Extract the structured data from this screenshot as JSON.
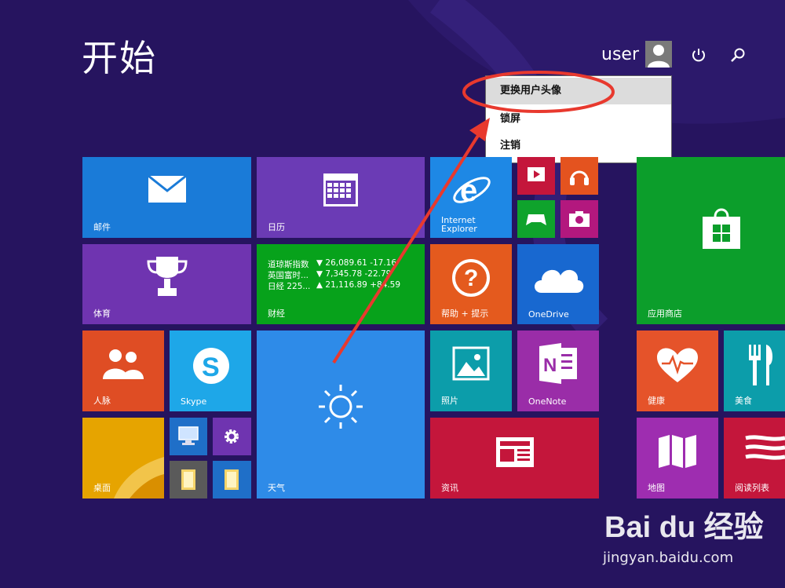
{
  "header": {
    "title": "开始",
    "user_name": "user",
    "icons": [
      "user-avatar-icon",
      "power-icon",
      "search-icon"
    ]
  },
  "user_menu": {
    "items": [
      {
        "label": "更换用户头像",
        "highlighted": true
      },
      {
        "label": "锁屏",
        "highlighted": false
      },
      {
        "label": "注销",
        "highlighted": false
      }
    ]
  },
  "tiles": {
    "mail": "邮件",
    "calendar": "日历",
    "ie": "Internet\nExplorer",
    "sports": "体育",
    "finance": "财经",
    "help": "帮助 + 提示",
    "onedrive": "OneDrive",
    "store": "应用商店",
    "people": "人脉",
    "skype": "Skype",
    "weather": "天气",
    "photos": "照片",
    "onenote": "OneNote",
    "health": "健康",
    "food": "美食",
    "desktop": "桌面",
    "news": "资讯",
    "maps": "地图",
    "reading": "阅读列表"
  },
  "finance_rows": [
    {
      "name": "道琼斯指数",
      "value": "▼ 26,089.61 -17.16"
    },
    {
      "name": "英国富时...",
      "value": "▼ 7,345.78 -22.79"
    },
    {
      "name": "日经 225...",
      "value": "▲ 21,116.89 +84.59"
    }
  ],
  "colors": {
    "background": "#26145f",
    "mail": "#1a7bd8",
    "calendar": "#6b3bb5",
    "ie": "#1e88e5",
    "sports": "#6f34b0",
    "finance": "#07a21b",
    "help": "#e45a1e",
    "onedrive": "#1868d0",
    "store": "#0c9e2b",
    "people": "#df4d24",
    "skype": "#1ea7e8",
    "weather": "#2e8be8",
    "photos": "#0c9daa",
    "onenote": "#9a2da8",
    "health": "#e5532a",
    "food": "#0c9daa",
    "desktop": "#e6a400",
    "news": "#c4163b",
    "maps": "#9e2db0",
    "reading": "#c4163b",
    "annotation": "#e8392e"
  },
  "watermark": {
    "logo": "Bai du 经验",
    "url": "jingyan.baidu.com"
  }
}
